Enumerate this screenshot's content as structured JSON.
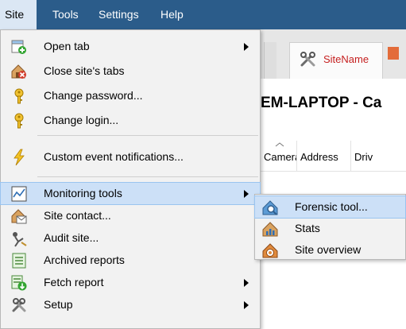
{
  "menubar": {
    "items": [
      {
        "label": "Site"
      },
      {
        "label": "Tools"
      },
      {
        "label": "Settings"
      },
      {
        "label": "Help"
      }
    ]
  },
  "background": {
    "tab_label": "SiteName",
    "system_title": "EM-LAPTOP - Ca",
    "columns": [
      "Camera",
      "Address",
      "Driv"
    ]
  },
  "site_menu": {
    "items": [
      {
        "label": "Open tab",
        "icon": "open-tab-icon"
      },
      {
        "label": "Close site's tabs",
        "icon": "close-tabs-icon"
      },
      {
        "label": "Change password...",
        "icon": "key-icon"
      },
      {
        "label": "Change login...",
        "icon": "key-icon"
      },
      {
        "label": "Custom event notifications...",
        "icon": "lightning-icon"
      },
      {
        "label": "Monitoring tools",
        "icon": "monitor-icon"
      },
      {
        "label": "Site contact...",
        "icon": "house-envelope-icon"
      },
      {
        "label": "Audit site...",
        "icon": "audit-icon"
      },
      {
        "label": "Archived reports",
        "icon": "archive-icon"
      },
      {
        "label": "Fetch report",
        "icon": "fetch-report-icon"
      },
      {
        "label": "Setup",
        "icon": "tools-icon"
      }
    ]
  },
  "monitoring_submenu": {
    "items": [
      {
        "label": "Forensic tool...",
        "icon": "forensic-icon"
      },
      {
        "label": "Stats",
        "icon": "stats-icon"
      },
      {
        "label": "Site overview",
        "icon": "site-overview-icon"
      }
    ]
  },
  "colors": {
    "menubar": "#2b5c8a",
    "menu_bg": "#f2f2f2",
    "highlight": "#cce0f7",
    "tab_text": "#c51f1f"
  }
}
